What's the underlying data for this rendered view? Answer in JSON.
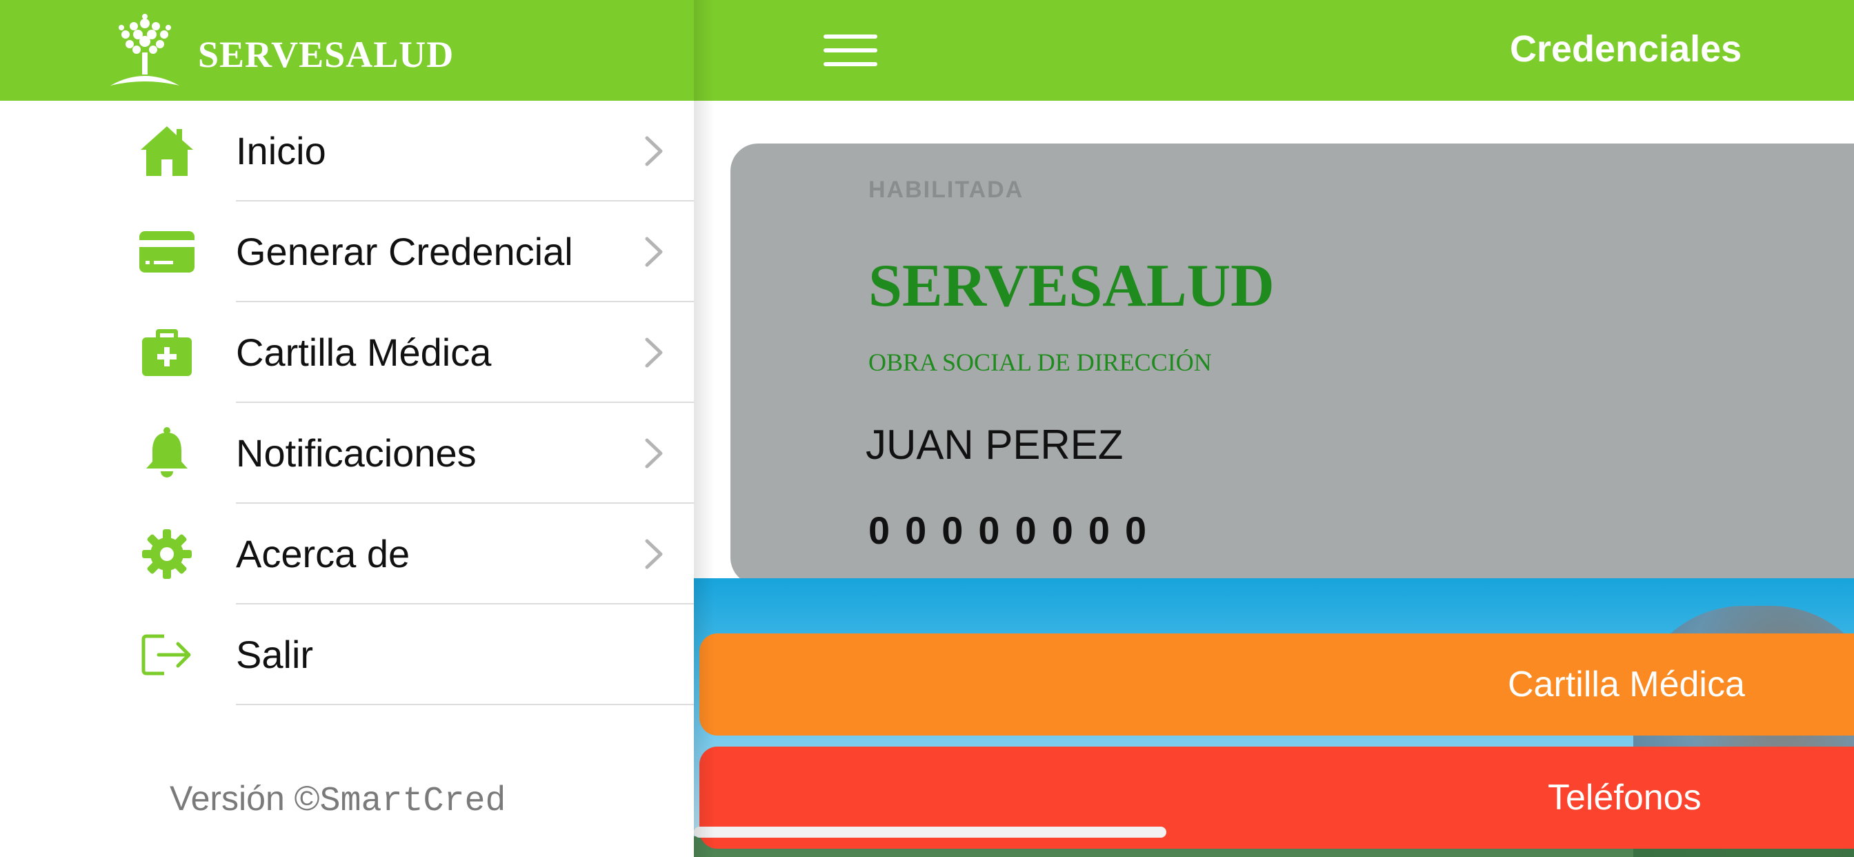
{
  "drawer": {
    "logo_text": "SERVESALUD",
    "items": [
      {
        "label": "Inicio",
        "icon": "home-icon"
      },
      {
        "label": "Generar Credencial",
        "icon": "credit-card-icon"
      },
      {
        "label": "Cartilla Médica",
        "icon": "medical-kit-icon"
      },
      {
        "label": "Notificaciones",
        "icon": "bell-icon"
      },
      {
        "label": "Acerca de",
        "icon": "gear-icon"
      },
      {
        "label": "Salir",
        "icon": "logout-icon"
      }
    ],
    "version_prefix": "Versión ©",
    "version_brand": "SmartCred"
  },
  "header": {
    "title": "Credenciales"
  },
  "card": {
    "status": "HABILITADA",
    "brand": "SERVESALUD",
    "subtitle": "OBRA SOCIAL DE DIRECCIÓN",
    "name": "JUAN PEREZ",
    "number": "00000000"
  },
  "buttons": {
    "cartilla": "Cartilla Médica",
    "telefonos": "Teléfonos"
  },
  "colors": {
    "brand_green": "#7ccd2b",
    "card_gray": "#a6aaaa",
    "card_text_green": "#1f8a1e",
    "orange": "#fc8a22",
    "red": "#fb432e"
  }
}
